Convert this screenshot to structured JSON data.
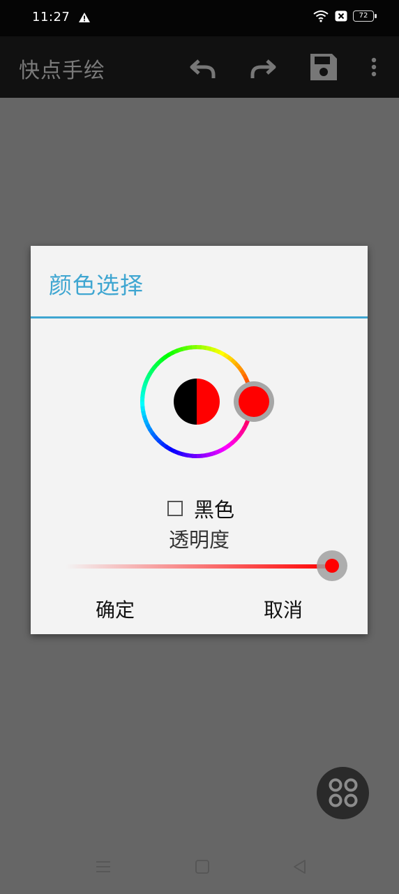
{
  "status_bar": {
    "time": "11:27",
    "battery": "72",
    "icons": [
      "warning-icon",
      "wifi-icon",
      "no-sim-icon",
      "battery-icon"
    ]
  },
  "toolbar": {
    "title": "快点手绘",
    "icons": [
      "undo-icon",
      "redo-icon",
      "save-icon",
      "more-vert-icon"
    ]
  },
  "dialog": {
    "title": "颜色选择",
    "black_checkbox": {
      "label": "黑色",
      "checked": false
    },
    "opacity_label": "透明度",
    "opacity_value": 1.0,
    "confirm_label": "确定",
    "cancel_label": "取消",
    "selected_color": "#ff0000",
    "old_color": "#000000",
    "accent_color": "#3fa6d1"
  },
  "fab": {
    "icon": "four-dots-icon"
  },
  "nav_bar": {
    "icons": [
      "menu-icon",
      "home-icon",
      "back-icon"
    ]
  }
}
